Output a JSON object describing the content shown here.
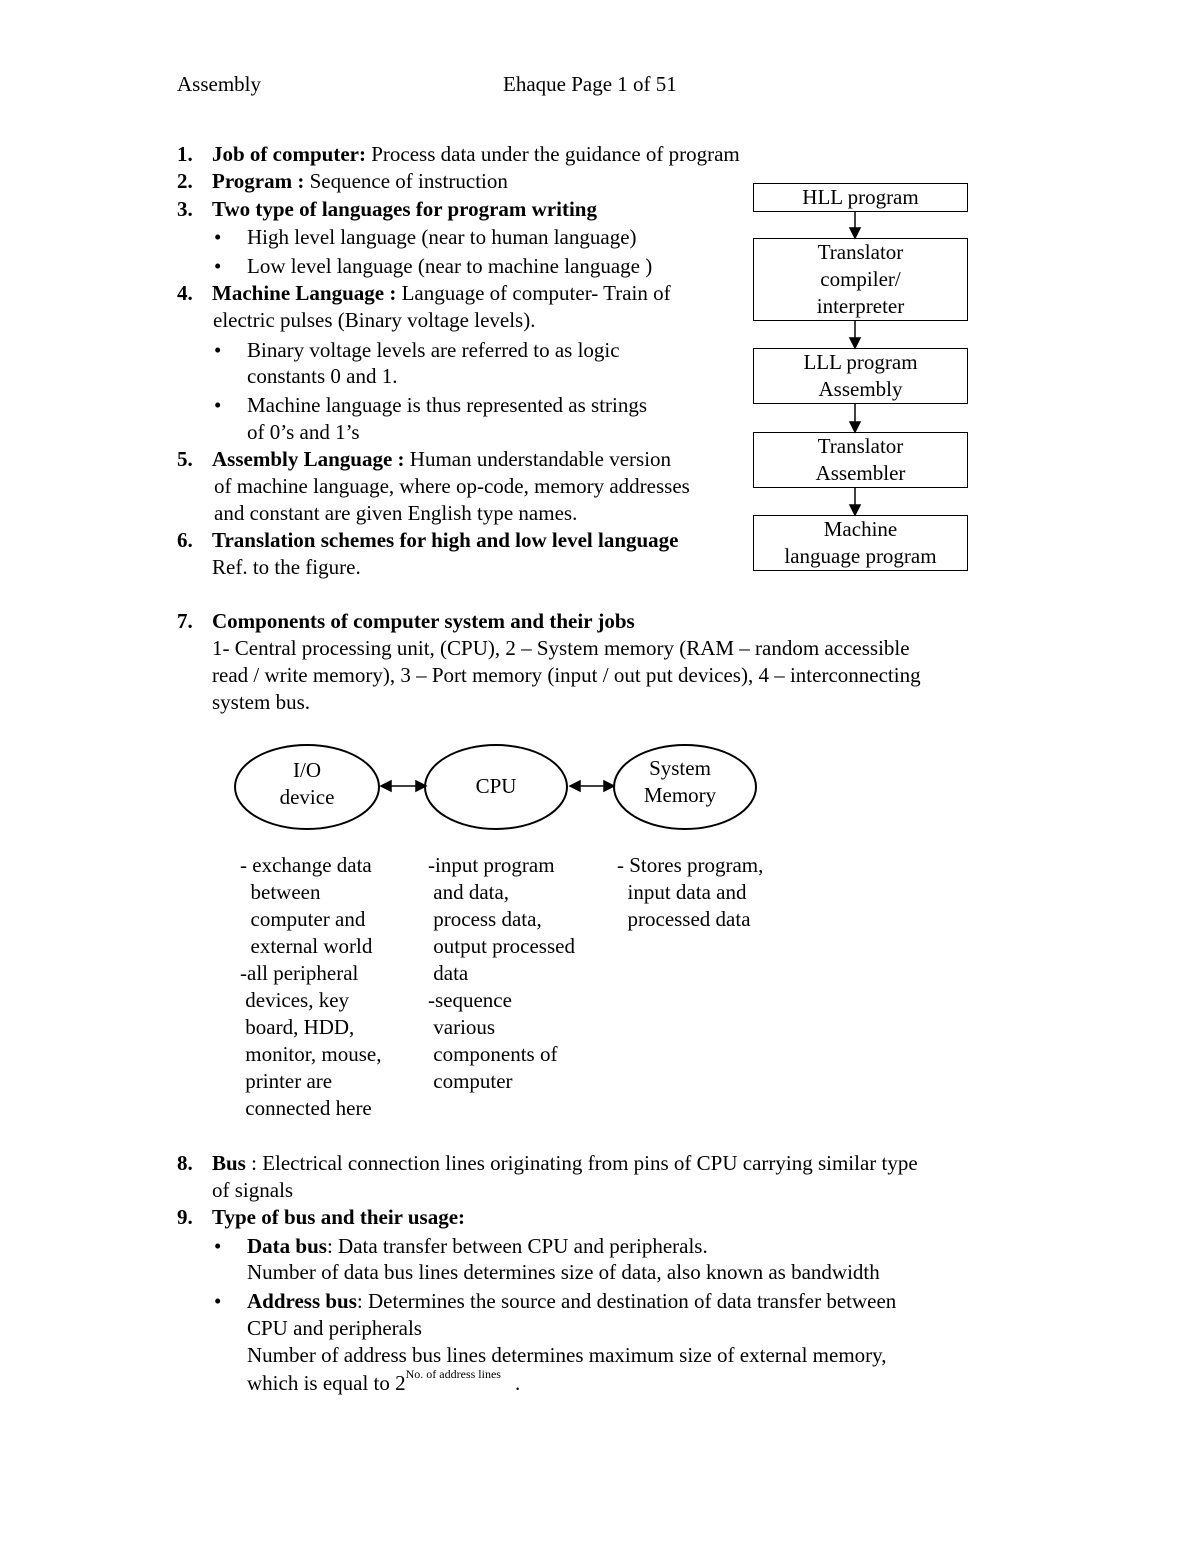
{
  "header": {
    "left": "Assembly",
    "right": "Ehaque Page 1 of 51"
  },
  "items": {
    "i1": {
      "num": "1.",
      "term": "Job of computer:",
      "text": " Process data under the guidance of program"
    },
    "i2": {
      "num": "2.",
      "term": "Program :",
      "text": " Sequence of instruction"
    },
    "i3": {
      "num": "3.",
      "term": "Two type of languages for program writing",
      "bullets": [
        "High level language  (near to human language)",
        "Low level language   (near to machine language )"
      ]
    },
    "i4": {
      "num": "4.",
      "term": "Machine Language :",
      "text": " Language of computer- Train of",
      "line2": "electric pulses (Binary voltage levels).",
      "bullets": [
        {
          "l1": "Binary voltage levels are referred to as logic",
          "l2": "constants 0 and 1."
        },
        {
          "l1": "Machine language is thus represented as strings",
          "l2": "of 0’s and 1’s"
        }
      ]
    },
    "i5": {
      "num": "5.",
      "term": "Assembly Language :",
      "text": " Human understandable version",
      "line2": "of machine language, where op-code, memory addresses",
      "line3": "and  constant are given English type names."
    },
    "i6": {
      "num": "6.",
      "term": "Translation schemes for high and low level language",
      "line2": "Ref. to the figure."
    },
    "i7": {
      "num": "7.",
      "term": "Components of computer system and their jobs",
      "line2": "1- Central processing unit, (CPU), 2 – System memory (RAM – random accessible",
      "line3": "read / write memory), 3 – Port memory (input / out put devices), 4 – interconnecting",
      "line4": "system bus."
    },
    "i8": {
      "num": "8.",
      "term": "Bus",
      "text": " : Electrical connection lines originating from pins of CPU carrying similar type",
      "line2": "of signals"
    },
    "i9": {
      "num": "9.",
      "term": "Type of bus and their usage:",
      "data_bus": {
        "term": "Data bus",
        "text": ": Data transfer between CPU and peripherals.",
        "line2": "Number of data bus lines determines size of data, also known as bandwidth"
      },
      "address_bus": {
        "term": "Address bus",
        "text": ": Determines the source and destination of data transfer between",
        "line2": "CPU and peripherals",
        "line3": "Number of address bus lines determines maximum size of external memory,",
        "line4_pre": "which is equal to 2",
        "line4_sup": "No. of address lines",
        "line4_post": "."
      }
    }
  },
  "flowchart": {
    "boxes": [
      {
        "l1": "HLL program"
      },
      {
        "l1": "Translator",
        "l2": "compiler/",
        "l3": "interpreter"
      },
      {
        "l1": "LLL program",
        "l2": "Assembly"
      },
      {
        "l1": "Translator",
        "l2": "Assembler"
      },
      {
        "l1": "Machine",
        "l2": "language program"
      }
    ]
  },
  "components_diagram": {
    "nodes": [
      {
        "l1": "I/O",
        "l2": "device"
      },
      {
        "l1": "CPU"
      },
      {
        "l1": "System",
        "l2": "Memory"
      }
    ],
    "descriptions": {
      "io": [
        "- exchange data",
        "  between",
        "  computer and",
        "  external world",
        "-all peripheral",
        " devices, key",
        " board, HDD,",
        " monitor, mouse,",
        " printer are",
        " connected here"
      ],
      "cpu": [
        "-input program",
        " and data,",
        " process data,",
        " output processed",
        " data",
        "-sequence",
        " various",
        " components of",
        " computer"
      ],
      "memory": [
        "- Stores program,",
        "  input data and",
        "  processed data"
      ]
    }
  }
}
